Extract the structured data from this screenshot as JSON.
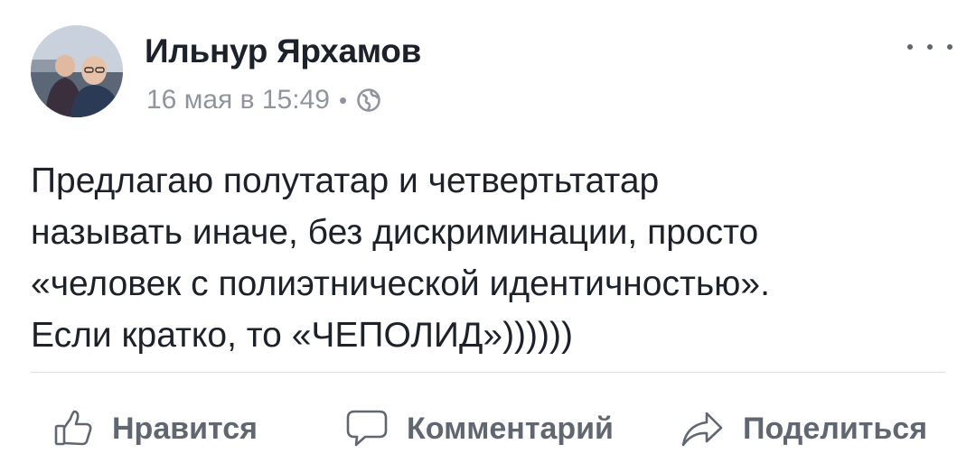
{
  "author": {
    "name": "Ильнур Ярхамов"
  },
  "meta": {
    "timestamp": "16 мая в 15:49",
    "separator": "•",
    "privacy_icon": "globe-icon"
  },
  "post": {
    "lines": [
      "Предлагаю полутатар и четвертьтатар",
      "называть иначе, без дискриминации, просто",
      "«человек с полиэтнической идентичностью».",
      "Если кратко, то «ЧЕПОЛИД»))))))"
    ]
  },
  "actions": {
    "like_label": "Нравится",
    "comment_label": "Комментарий",
    "share_label": "Поделиться"
  },
  "colors": {
    "text": "#1d2129",
    "secondary": "#90949c",
    "action": "#606770",
    "divider": "#dadde1"
  }
}
